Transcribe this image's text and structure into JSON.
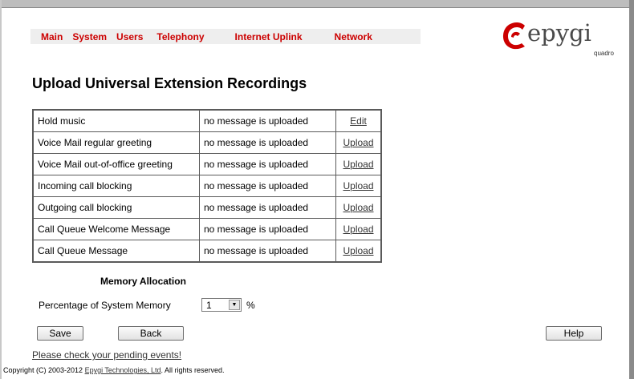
{
  "menu": {
    "items": [
      {
        "label": "Main"
      },
      {
        "label": "System"
      },
      {
        "label": "Users"
      },
      {
        "label": "Telephony"
      },
      {
        "label": "Internet Uplink"
      },
      {
        "label": "Network"
      }
    ]
  },
  "logo": {
    "wordmark": "epygi",
    "sub": "quadro",
    "accent_color": "#cc0000"
  },
  "page_title": "Upload Universal Extension Recordings",
  "recordings": [
    {
      "name": "Hold music",
      "status": "no message is uploaded",
      "action": "Edit"
    },
    {
      "name": "Voice Mail regular greeting",
      "status": "no message is uploaded",
      "action": "Upload"
    },
    {
      "name": "Voice Mail out-of-office greeting",
      "status": "no message is uploaded",
      "action": "Upload"
    },
    {
      "name": "Incoming call blocking",
      "status": "no message is uploaded",
      "action": "Upload"
    },
    {
      "name": "Outgoing call blocking",
      "status": "no message is uploaded",
      "action": "Upload"
    },
    {
      "name": "Call Queue Welcome Message",
      "status": "no message is uploaded",
      "action": "Upload"
    },
    {
      "name": "Call Queue Message",
      "status": "no message is uploaded",
      "action": "Upload"
    }
  ],
  "memory": {
    "heading": "Memory Allocation",
    "label": "Percentage of System Memory",
    "value": "1",
    "unit": "%"
  },
  "buttons": {
    "save": "Save",
    "back": "Back",
    "help": "Help"
  },
  "footer": {
    "pending_link": "Please check your pending events!",
    "copyright_prefix": "Copyright (C) 2003-2012 ",
    "copyright_link": "Epygi Technologies, Ltd",
    "copyright_suffix": ". All rights reserved."
  }
}
